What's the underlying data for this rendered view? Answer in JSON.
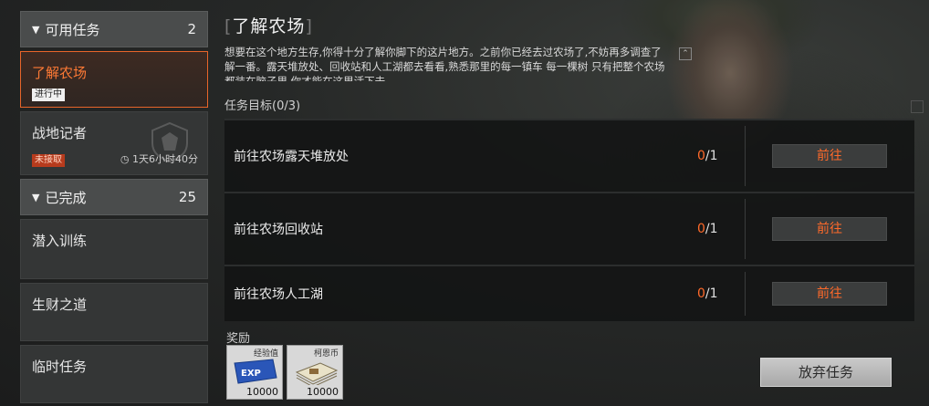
{
  "sidebar": {
    "available": {
      "label": "可用任务",
      "count": "2"
    },
    "available_items": [
      {
        "title": "了解农场",
        "badge": "进行中"
      },
      {
        "title": "战地记者",
        "badge": "未接取",
        "timer": "1天6小时40分"
      }
    ],
    "completed": {
      "label": "已完成",
      "count": "25"
    },
    "completed_items": [
      {
        "title": "潜入训练"
      },
      {
        "title": "生财之道"
      },
      {
        "title": "临时任务"
      }
    ]
  },
  "main": {
    "title": "了解农场",
    "description": "想要在这个地方生存,你得十分了解你脚下的这片地方。之前你已经去过农场了,不妨再多调查了解一番。露天堆放处、回收站和人工湖都去看看,熟悉那里的每一镇车 每一棵树 只有把整个农场都装在脑子里 你才能在这里活下去",
    "objectives_header": "任务目标(0/3)",
    "objectives": [
      {
        "label": "前往农场露天堆放处",
        "current": "0",
        "total": "/1",
        "button": "前往"
      },
      {
        "label": "前往农场回收站",
        "current": "0",
        "total": "/1",
        "button": "前往"
      },
      {
        "label": "前往农场人工湖",
        "current": "0",
        "total": "/1",
        "button": "前往"
      }
    ],
    "rewards_label": "奖励",
    "rewards": [
      {
        "name": "经验值",
        "amount": "10000",
        "icon": "exp-ticket-icon"
      },
      {
        "name": "柯恩币",
        "amount": "10000",
        "icon": "money-stack-icon"
      }
    ],
    "abandon_button": "放弃任务"
  },
  "colors": {
    "accent": "#ff6a2a",
    "active_border": "#e8652a"
  }
}
